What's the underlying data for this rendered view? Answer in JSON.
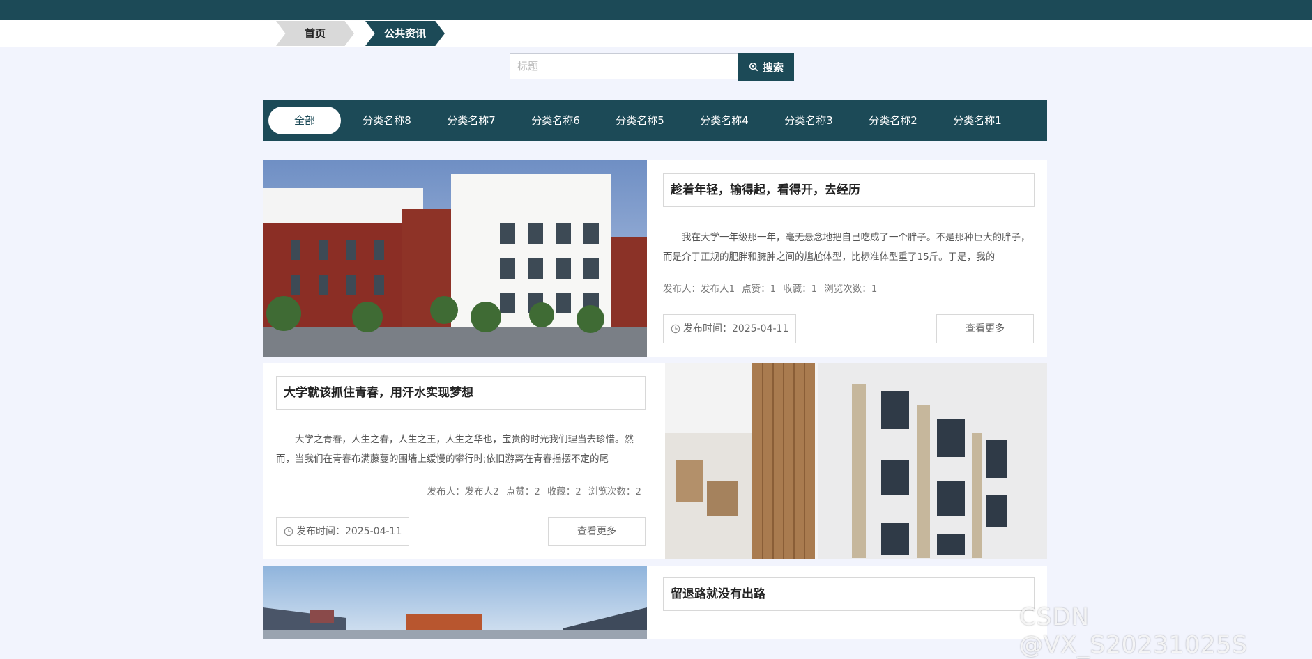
{
  "breadcrumb": {
    "home": "首页",
    "current": "公共资讯"
  },
  "search": {
    "placeholder": "标题",
    "button": "搜索"
  },
  "categories": [
    "全部",
    "分类名称8",
    "分类名称7",
    "分类名称6",
    "分类名称5",
    "分类名称4",
    "分类名称3",
    "分类名称2",
    "分类名称1"
  ],
  "articles": [
    {
      "title": "趁着年轻，输得起，看得开，去经历",
      "excerpt": "我在大学一年级那一年，毫无悬念地把自己吃成了一个胖子。不是那种巨大的胖子，而是介于正规的肥胖和臃肿之间的尴尬体型，比标准体型重了15斤。于是，我的",
      "publisher": "发布人：发布人1",
      "likes": "点赞：1",
      "favorites": "收藏：1",
      "views": "浏览次数：1",
      "date": "发布时间：2025-04-11",
      "more": "查看更多"
    },
    {
      "title": "大学就该抓住青春，用汗水实现梦想",
      "excerpt": "大学之青春，人生之春，人生之王，人生之华也，宝贵的时光我们理当去珍惜。然而，当我们在青春布满藤蔓的围墙上缓慢的攀行时;依旧游离在青春摇摆不定的尾",
      "publisher": "发布人：发布人2",
      "likes": "点赞：2",
      "favorites": "收藏：2",
      "views": "浏览次数：2",
      "date": "发布时间：2025-04-11",
      "more": "查看更多"
    },
    {
      "title": "留退路就没有出路",
      "excerpt": "",
      "publisher": "",
      "likes": "",
      "favorites": "",
      "views": "",
      "date": "",
      "more": ""
    }
  ],
  "watermark": "CSDN @VX_S20231025S",
  "colors": {
    "primary": "#1c4a57",
    "background": "#f2f4fd"
  }
}
